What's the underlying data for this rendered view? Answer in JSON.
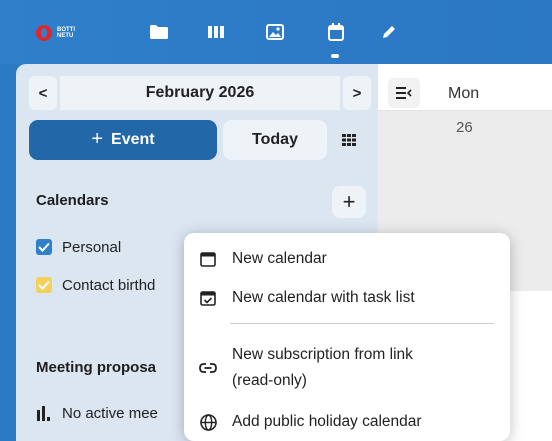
{
  "topbar": {
    "logo_text": "BOTTI NETU",
    "apps": [
      {
        "icon": "folder-icon"
      },
      {
        "icon": "deck-icon"
      },
      {
        "icon": "photos-icon"
      },
      {
        "icon": "calendar-icon",
        "active": true
      },
      {
        "icon": "pencil-icon"
      }
    ]
  },
  "sidebar": {
    "month": "February 2026",
    "prev_label": "<",
    "next_label": ">",
    "event_button": "Event",
    "event_plus": "+",
    "today_button": "Today",
    "calendars_title": "Calendars",
    "add_calendar_label": "+",
    "calendars": [
      {
        "label": "Personal",
        "color": "#2f7fcb",
        "checked": true
      },
      {
        "label": "Contact birthd",
        "color": "#f3d15a",
        "checked": true
      }
    ],
    "meeting_title": "Meeting proposa",
    "meeting_empty": "No active mee"
  },
  "main": {
    "day_name": "Mon",
    "day_number": "26"
  },
  "menu": {
    "items": [
      {
        "label": "New calendar",
        "icon": "calendar-blank-icon"
      },
      {
        "label": "New calendar with task list",
        "icon": "calendar-check-icon"
      },
      {
        "label_line1": "New subscription from link",
        "label_line2": "(read-only)",
        "icon": "link-icon"
      },
      {
        "label": "Add public holiday calendar",
        "icon": "globe-icon"
      }
    ]
  },
  "colors": {
    "topbar": "#2f7fcb",
    "sidebar": "#dbe6f1",
    "primary_button": "#2267a8",
    "logo_red": "#e0262c"
  }
}
